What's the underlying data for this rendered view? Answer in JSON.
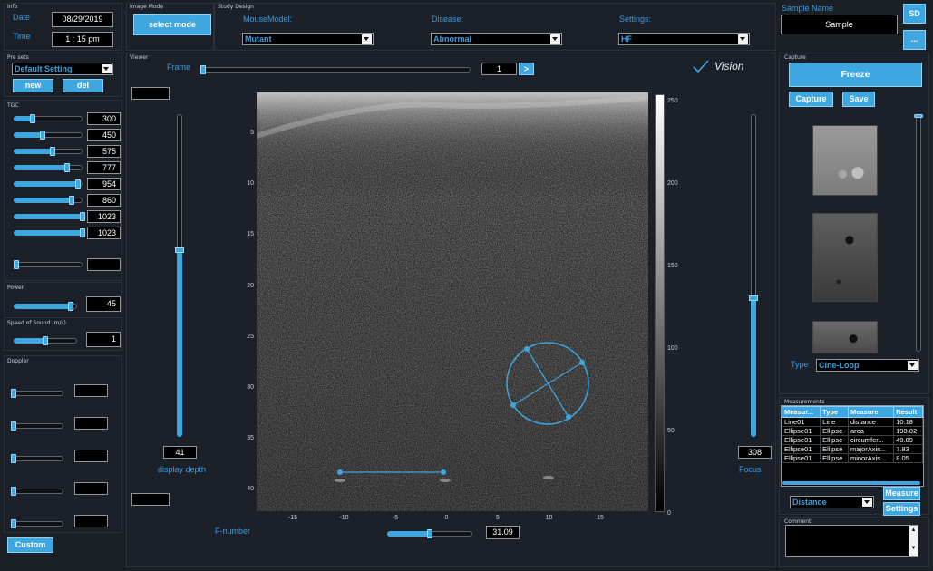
{
  "info": {
    "caption": "Info",
    "date_label": "Date",
    "date_value": "08/29/2019",
    "time_label": "Time",
    "time_value": "1 : 15 pm"
  },
  "image_mode": {
    "caption": "Image Mode",
    "button": "select mode"
  },
  "study_design": {
    "caption": "Study Design",
    "mouse_model_label": "MouseModel:",
    "mouse_model_value": "Mutant",
    "disease_label": "Disease:",
    "disease_value": "Abnormal",
    "settings_label": "Settings:",
    "settings_value": "HF"
  },
  "sample": {
    "label": "Sample Name",
    "value": "Sample",
    "sd_button": "SD",
    "more_button": "..."
  },
  "presets": {
    "caption": "Pre sets",
    "selected": "Default Setting",
    "new_button": "new",
    "del_button": "del"
  },
  "tgc": {
    "caption": "TGC",
    "values": [
      "300",
      "450",
      "575",
      "777",
      "954",
      "860",
      "1023",
      "1023"
    ],
    "levels": [
      0.28,
      0.42,
      0.56,
      0.77,
      0.93,
      0.84,
      1.0,
      1.0
    ],
    "extra_level": 0.02,
    "extra_value": ""
  },
  "power": {
    "caption": "Power",
    "value": "45",
    "level": 0.9
  },
  "speed_of_sound": {
    "caption": "Speed of Sound (m/s)",
    "value": "1",
    "level": 0.5
  },
  "doppler": {
    "caption": "Doppler",
    "levels": [
      0.0,
      0.0,
      0.0,
      0.0,
      0.0
    ],
    "values": [
      "",
      "",
      "",
      "",
      ""
    ]
  },
  "custom_button": "Custom",
  "viewer": {
    "caption": "Viewer",
    "frame_label": "Frame",
    "frame_value": "1",
    "frame_level": 0.0,
    "next_button": ">",
    "brand": "Vision",
    "display_depth_value": "41",
    "display_depth_label": "display depth",
    "depth_level": 0.58,
    "focus_value": "308",
    "focus_label": "Focus",
    "focus_level": 0.43,
    "fnumber_label": "F-number",
    "fnumber_value": "31.09",
    "fnumber_level": 0.5,
    "y_ticks": [
      "5",
      "10",
      "15",
      "20",
      "25",
      "30",
      "35",
      "40"
    ],
    "x_ticks": [
      "-15",
      "-10",
      "-5",
      "0",
      "5",
      "10",
      "15"
    ],
    "colorbar_ticks": [
      "250",
      "200",
      "150",
      "100",
      "50",
      "0"
    ]
  },
  "capture": {
    "caption": "Capture",
    "freeze_button": "Freeze",
    "capture_button": "Capture",
    "save_button": "Save",
    "type_label": "Type",
    "type_value": "Cine-Loop"
  },
  "measurements": {
    "caption": "Measurements",
    "headers": [
      "Measur...",
      "Type",
      "Measure",
      "Result"
    ],
    "rows": [
      [
        "Line01",
        "Line",
        "distance",
        "10.18"
      ],
      [
        "Ellipse01",
        "Ellipse",
        "area",
        "198.02"
      ],
      [
        "Ellipse01",
        "Ellipse",
        "circumfer...",
        "49.89"
      ],
      [
        "Ellipse01",
        "Ellipse",
        "majorAxis...",
        "7.83"
      ],
      [
        "Ellipse01",
        "Ellipse",
        "minorAxis...",
        "8.05"
      ]
    ],
    "tool_value": "Distance",
    "measure_button": "Measure",
    "settings_button": "Settings"
  },
  "comment": {
    "caption": "Comment",
    "value": ""
  },
  "colors": {
    "accent": "#3ea7df",
    "background": "#1b1f26",
    "label": "#3d9be0"
  }
}
